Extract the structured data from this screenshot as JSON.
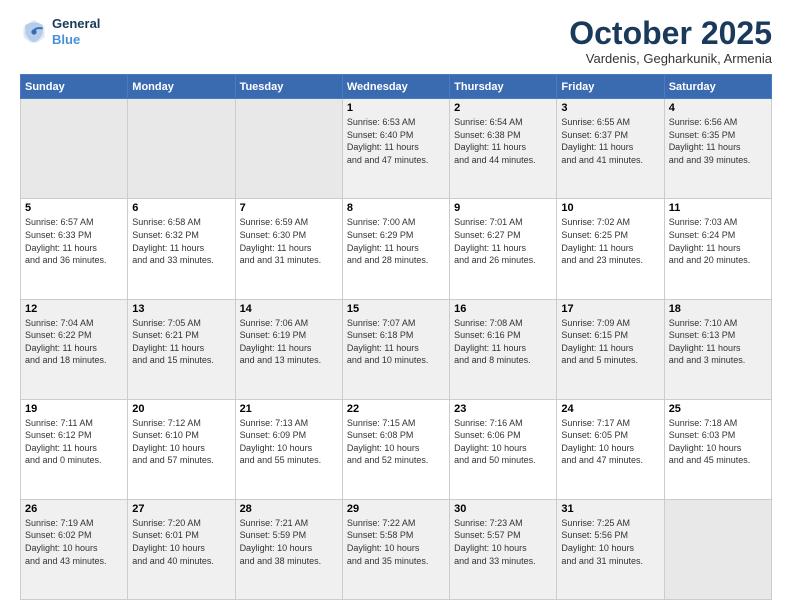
{
  "header": {
    "logo_line1": "General",
    "logo_line2": "Blue",
    "month": "October 2025",
    "location": "Vardenis, Gegharkunik, Armenia"
  },
  "weekdays": [
    "Sunday",
    "Monday",
    "Tuesday",
    "Wednesday",
    "Thursday",
    "Friday",
    "Saturday"
  ],
  "weeks": [
    [
      {
        "date": "",
        "sunrise": "",
        "sunset": "",
        "daylight": "",
        "empty": true
      },
      {
        "date": "",
        "sunrise": "",
        "sunset": "",
        "daylight": "",
        "empty": true
      },
      {
        "date": "",
        "sunrise": "",
        "sunset": "",
        "daylight": "",
        "empty": true
      },
      {
        "date": "1",
        "sunrise": "Sunrise: 6:53 AM",
        "sunset": "Sunset: 6:40 PM",
        "daylight": "Daylight: 11 hours and 47 minutes."
      },
      {
        "date": "2",
        "sunrise": "Sunrise: 6:54 AM",
        "sunset": "Sunset: 6:38 PM",
        "daylight": "Daylight: 11 hours and 44 minutes."
      },
      {
        "date": "3",
        "sunrise": "Sunrise: 6:55 AM",
        "sunset": "Sunset: 6:37 PM",
        "daylight": "Daylight: 11 hours and 41 minutes."
      },
      {
        "date": "4",
        "sunrise": "Sunrise: 6:56 AM",
        "sunset": "Sunset: 6:35 PM",
        "daylight": "Daylight: 11 hours and 39 minutes."
      }
    ],
    [
      {
        "date": "5",
        "sunrise": "Sunrise: 6:57 AM",
        "sunset": "Sunset: 6:33 PM",
        "daylight": "Daylight: 11 hours and 36 minutes."
      },
      {
        "date": "6",
        "sunrise": "Sunrise: 6:58 AM",
        "sunset": "Sunset: 6:32 PM",
        "daylight": "Daylight: 11 hours and 33 minutes."
      },
      {
        "date": "7",
        "sunrise": "Sunrise: 6:59 AM",
        "sunset": "Sunset: 6:30 PM",
        "daylight": "Daylight: 11 hours and 31 minutes."
      },
      {
        "date": "8",
        "sunrise": "Sunrise: 7:00 AM",
        "sunset": "Sunset: 6:29 PM",
        "daylight": "Daylight: 11 hours and 28 minutes."
      },
      {
        "date": "9",
        "sunrise": "Sunrise: 7:01 AM",
        "sunset": "Sunset: 6:27 PM",
        "daylight": "Daylight: 11 hours and 26 minutes."
      },
      {
        "date": "10",
        "sunrise": "Sunrise: 7:02 AM",
        "sunset": "Sunset: 6:25 PM",
        "daylight": "Daylight: 11 hours and 23 minutes."
      },
      {
        "date": "11",
        "sunrise": "Sunrise: 7:03 AM",
        "sunset": "Sunset: 6:24 PM",
        "daylight": "Daylight: 11 hours and 20 minutes."
      }
    ],
    [
      {
        "date": "12",
        "sunrise": "Sunrise: 7:04 AM",
        "sunset": "Sunset: 6:22 PM",
        "daylight": "Daylight: 11 hours and 18 minutes."
      },
      {
        "date": "13",
        "sunrise": "Sunrise: 7:05 AM",
        "sunset": "Sunset: 6:21 PM",
        "daylight": "Daylight: 11 hours and 15 minutes."
      },
      {
        "date": "14",
        "sunrise": "Sunrise: 7:06 AM",
        "sunset": "Sunset: 6:19 PM",
        "daylight": "Daylight: 11 hours and 13 minutes."
      },
      {
        "date": "15",
        "sunrise": "Sunrise: 7:07 AM",
        "sunset": "Sunset: 6:18 PM",
        "daylight": "Daylight: 11 hours and 10 minutes."
      },
      {
        "date": "16",
        "sunrise": "Sunrise: 7:08 AM",
        "sunset": "Sunset: 6:16 PM",
        "daylight": "Daylight: 11 hours and 8 minutes."
      },
      {
        "date": "17",
        "sunrise": "Sunrise: 7:09 AM",
        "sunset": "Sunset: 6:15 PM",
        "daylight": "Daylight: 11 hours and 5 minutes."
      },
      {
        "date": "18",
        "sunrise": "Sunrise: 7:10 AM",
        "sunset": "Sunset: 6:13 PM",
        "daylight": "Daylight: 11 hours and 3 minutes."
      }
    ],
    [
      {
        "date": "19",
        "sunrise": "Sunrise: 7:11 AM",
        "sunset": "Sunset: 6:12 PM",
        "daylight": "Daylight: 11 hours and 0 minutes."
      },
      {
        "date": "20",
        "sunrise": "Sunrise: 7:12 AM",
        "sunset": "Sunset: 6:10 PM",
        "daylight": "Daylight: 10 hours and 57 minutes."
      },
      {
        "date": "21",
        "sunrise": "Sunrise: 7:13 AM",
        "sunset": "Sunset: 6:09 PM",
        "daylight": "Daylight: 10 hours and 55 minutes."
      },
      {
        "date": "22",
        "sunrise": "Sunrise: 7:15 AM",
        "sunset": "Sunset: 6:08 PM",
        "daylight": "Daylight: 10 hours and 52 minutes."
      },
      {
        "date": "23",
        "sunrise": "Sunrise: 7:16 AM",
        "sunset": "Sunset: 6:06 PM",
        "daylight": "Daylight: 10 hours and 50 minutes."
      },
      {
        "date": "24",
        "sunrise": "Sunrise: 7:17 AM",
        "sunset": "Sunset: 6:05 PM",
        "daylight": "Daylight: 10 hours and 47 minutes."
      },
      {
        "date": "25",
        "sunrise": "Sunrise: 7:18 AM",
        "sunset": "Sunset: 6:03 PM",
        "daylight": "Daylight: 10 hours and 45 minutes."
      }
    ],
    [
      {
        "date": "26",
        "sunrise": "Sunrise: 7:19 AM",
        "sunset": "Sunset: 6:02 PM",
        "daylight": "Daylight: 10 hours and 43 minutes."
      },
      {
        "date": "27",
        "sunrise": "Sunrise: 7:20 AM",
        "sunset": "Sunset: 6:01 PM",
        "daylight": "Daylight: 10 hours and 40 minutes."
      },
      {
        "date": "28",
        "sunrise": "Sunrise: 7:21 AM",
        "sunset": "Sunset: 5:59 PM",
        "daylight": "Daylight: 10 hours and 38 minutes."
      },
      {
        "date": "29",
        "sunrise": "Sunrise: 7:22 AM",
        "sunset": "Sunset: 5:58 PM",
        "daylight": "Daylight: 10 hours and 35 minutes."
      },
      {
        "date": "30",
        "sunrise": "Sunrise: 7:23 AM",
        "sunset": "Sunset: 5:57 PM",
        "daylight": "Daylight: 10 hours and 33 minutes."
      },
      {
        "date": "31",
        "sunrise": "Sunrise: 7:25 AM",
        "sunset": "Sunset: 5:56 PM",
        "daylight": "Daylight: 10 hours and 31 minutes."
      },
      {
        "date": "",
        "sunrise": "",
        "sunset": "",
        "daylight": "",
        "empty": true
      }
    ]
  ]
}
